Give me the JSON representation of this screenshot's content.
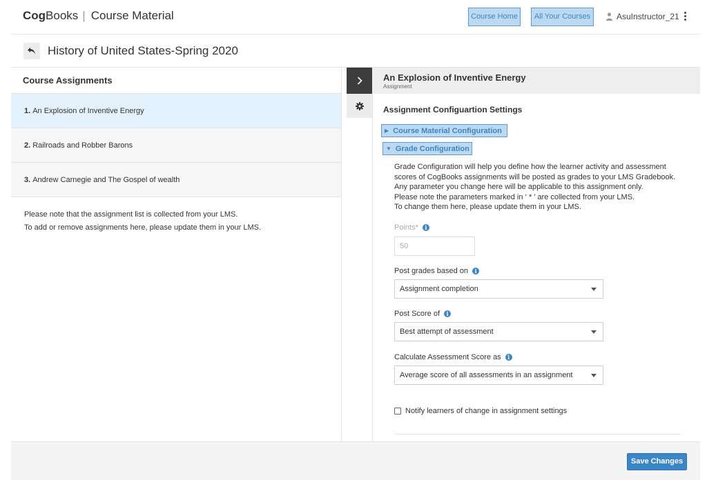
{
  "header": {
    "brand_bold": "Cog",
    "brand_rest": "Books",
    "separator": "|",
    "section": "Course Material",
    "nav": {
      "course_home": "Course Home",
      "all_courses": "All Your Courses"
    },
    "user_name": "AsuInstructor_21"
  },
  "course": {
    "title": "History of United States-Spring 2020"
  },
  "assignments_panel": {
    "heading": "Course Assignments",
    "items": [
      {
        "num": "1.",
        "label": "An Explosion of Inventive Energy"
      },
      {
        "num": "2.",
        "label": "Railroads and Robber Barons"
      },
      {
        "num": "3.",
        "label": "Andrew Carnegie and The Gospel of wealth"
      }
    ],
    "note_lines": [
      "Please note that the assignment list is collected from your LMS.",
      "To add or remove assignments here, please update them in your LMS."
    ]
  },
  "details": {
    "title": "An Explosion of Inventive Energy",
    "subtitle": "Assignment",
    "settings_heading": "Assignment Configuartion Settings",
    "accordions": {
      "course_material": "Course Material Configuration",
      "grade": "Grade Configuration"
    },
    "grade_description": [
      "Grade Configuration will help you define how the learner activity and assessment",
      "scores of CogBooks assignments will be posted as grades to your LMS Gradebook.",
      "Any parameter you change here will be applicable to this assignment only.",
      "Please note the parameters marked in ‘ * ’  are collected from your LMS.",
      "To change them here, please update them in your LMS."
    ],
    "fields": {
      "points_label": "Points*",
      "points_value": "50",
      "post_grades_label": "Post grades based on",
      "post_grades_value": "Assignment completion",
      "post_score_label": "Post Score of",
      "post_score_value": "Best attempt of assessment",
      "calc_label": "Calculate Assessment Score as",
      "calc_value": "Average score of all assessments in an assignment"
    },
    "notify_label": "Notify learners of change in assignment settings",
    "notify_checked": false
  },
  "footer": {
    "save_label": "Save Changes"
  },
  "icons": {
    "back": "back-arrow-icon",
    "expand": "chevron-right-icon",
    "settings": "gear-icon",
    "user": "user-icon",
    "menu": "kebab-menu-icon",
    "info": "info-icon"
  },
  "colors": {
    "accent": "#3a86c8",
    "highlight": "#bcd9f1",
    "active_row": "#e3f2fc",
    "rail_dark": "#3d3d3d"
  }
}
